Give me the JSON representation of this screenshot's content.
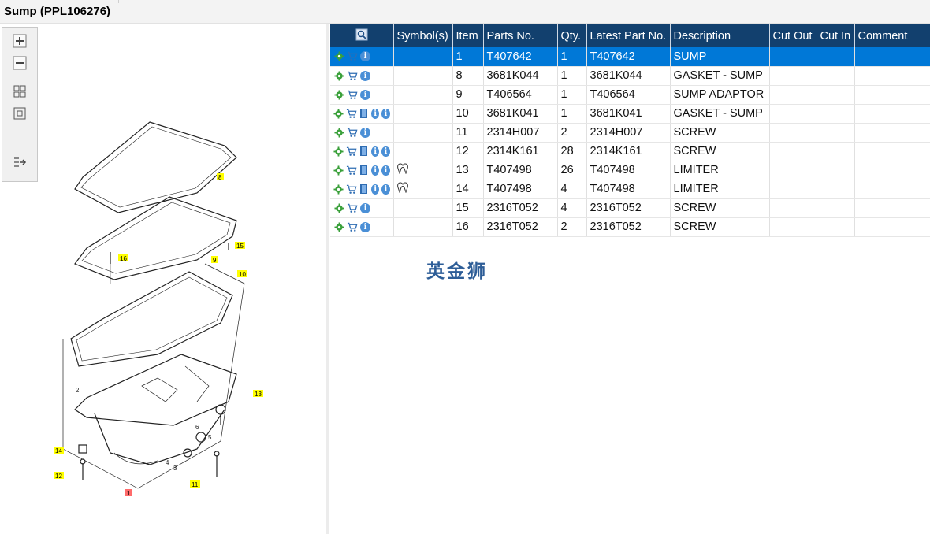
{
  "window": {
    "title": "Sump (PPL106276)"
  },
  "toolbar": {
    "buttons": [
      {
        "name": "zoom-in"
      },
      {
        "name": "zoom-out"
      },
      {
        "name": "fit-all"
      },
      {
        "name": "fit-window"
      },
      {
        "name": "export"
      }
    ]
  },
  "diagram": {
    "callouts": [
      "8",
      "9",
      "15",
      "16",
      "10",
      "2",
      "13",
      "6",
      "5",
      "3",
      "4",
      "14",
      "12",
      "11",
      "1"
    ]
  },
  "table": {
    "columns": [
      "",
      "Symbol(s)",
      "Item",
      "Parts No.",
      "Qty.",
      "Latest Part No.",
      "Description",
      "Cut Out",
      "Cut In",
      "Comment"
    ],
    "rows": [
      {
        "item": "1",
        "part_no": "T407642",
        "qty": "1",
        "latest": "T407642",
        "desc": "SUMP",
        "selected": true,
        "book": false,
        "extra_info": false,
        "symbol": false
      },
      {
        "item": "8",
        "part_no": "3681K044",
        "qty": "1",
        "latest": "3681K044",
        "desc": "GASKET - SUMP",
        "selected": false,
        "book": false,
        "extra_info": false,
        "symbol": false
      },
      {
        "item": "9",
        "part_no": "T406564",
        "qty": "1",
        "latest": "T406564",
        "desc": "SUMP ADAPTOR",
        "selected": false,
        "book": false,
        "extra_info": false,
        "symbol": false
      },
      {
        "item": "10",
        "part_no": "3681K041",
        "qty": "1",
        "latest": "3681K041",
        "desc": "GASKET - SUMP",
        "selected": false,
        "book": true,
        "extra_info": true,
        "symbol": false
      },
      {
        "item": "11",
        "part_no": "2314H007",
        "qty": "2",
        "latest": "2314H007",
        "desc": "SCREW",
        "selected": false,
        "book": false,
        "extra_info": false,
        "symbol": false
      },
      {
        "item": "12",
        "part_no": "2314K161",
        "qty": "28",
        "latest": "2314K161",
        "desc": "SCREW",
        "selected": false,
        "book": true,
        "extra_info": true,
        "symbol": false
      },
      {
        "item": "13",
        "part_no": "T407498",
        "qty": "26",
        "latest": "T407498",
        "desc": "LIMITER",
        "selected": false,
        "book": true,
        "extra_info": true,
        "symbol": true
      },
      {
        "item": "14",
        "part_no": "T407498",
        "qty": "4",
        "latest": "T407498",
        "desc": "LIMITER",
        "selected": false,
        "book": true,
        "extra_info": true,
        "symbol": true
      },
      {
        "item": "15",
        "part_no": "2316T052",
        "qty": "4",
        "latest": "2316T052",
        "desc": "SCREW",
        "selected": false,
        "book": false,
        "extra_info": false,
        "symbol": false
      },
      {
        "item": "16",
        "part_no": "2316T052",
        "qty": "2",
        "latest": "2316T052",
        "desc": "SCREW",
        "selected": false,
        "book": false,
        "extra_info": false,
        "symbol": false
      }
    ]
  },
  "watermark": {
    "text": "英金狮"
  },
  "colors": {
    "header": "#12406e",
    "selected": "#0078d7",
    "gear": "#3aa03a",
    "info": "#4a8fd6"
  }
}
